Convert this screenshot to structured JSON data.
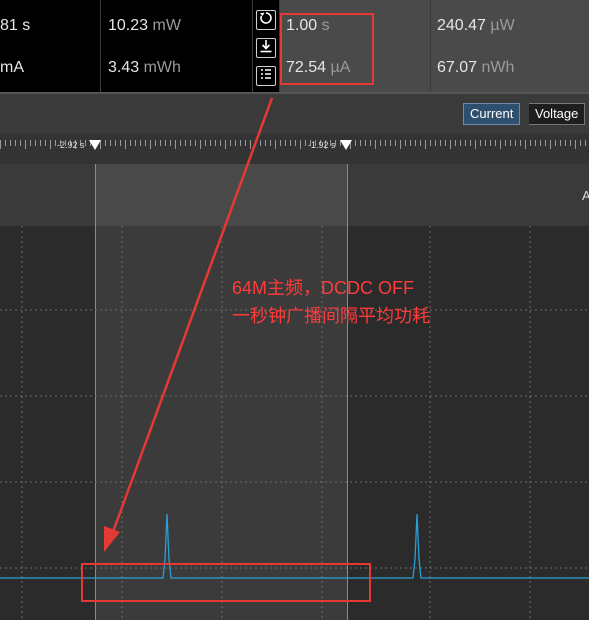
{
  "metrics": {
    "col1_top": "81 s",
    "col1_bottom": "mA",
    "col2_top_value": "10.23",
    "col2_top_unit": "mW",
    "col2_bottom_value": "3.43",
    "col2_bottom_unit": "mWh",
    "col3_top_value": "1.00",
    "col3_top_unit": "s",
    "col3_bottom_value": "72.54",
    "col3_bottom_unit": "µA",
    "col4_top_value": "240.47",
    "col4_top_unit": "µW",
    "col4_bottom_value": "67.07",
    "col4_bottom_unit": "nWh"
  },
  "toolbar": {
    "current_label": "Current",
    "voltage_label": "Voltage",
    "right_edge_label": "A"
  },
  "ruler": {
    "marker1_label": "-2.92 s",
    "marker2_label": "-1.92 s"
  },
  "annotation": {
    "line1": "64M主频，DCDC OFF",
    "line2": "一秒钟广播间隔平均功耗"
  },
  "colors": {
    "accent_red": "#ff3b3b",
    "trace": "#2a9fd6"
  },
  "icons": [
    "reset-icon",
    "download-icon",
    "list-icon"
  ]
}
